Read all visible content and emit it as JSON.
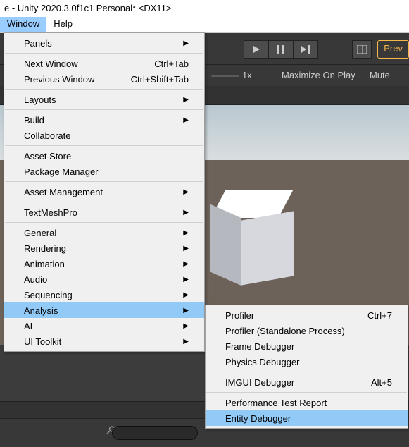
{
  "title": "e - Unity 2020.3.0f1c1 Personal* <DX11>",
  "menubar": {
    "window": "Window",
    "help": "Help"
  },
  "toolbar": {
    "preview": "Prev"
  },
  "playbar": {
    "scale": "1x",
    "maximize": "Maximize On Play",
    "mute": "Mute"
  },
  "window_menu": {
    "panels": "Panels",
    "next_window": "Next Window",
    "next_window_sc": "Ctrl+Tab",
    "previous_window": "Previous Window",
    "previous_window_sc": "Ctrl+Shift+Tab",
    "layouts": "Layouts",
    "build": "Build",
    "collaborate": "Collaborate",
    "asset_store": "Asset Store",
    "package_manager": "Package Manager",
    "asset_management": "Asset Management",
    "textmeshpro": "TextMeshPro",
    "general": "General",
    "rendering": "Rendering",
    "animation": "Animation",
    "audio": "Audio",
    "sequencing": "Sequencing",
    "analysis": "Analysis",
    "ai": "AI",
    "ui_toolkit": "UI Toolkit"
  },
  "analysis_menu": {
    "profiler": "Profiler",
    "profiler_sc": "Ctrl+7",
    "profiler_sa": "Profiler (Standalone Process)",
    "frame_debugger": "Frame Debugger",
    "physics_debugger": "Physics Debugger",
    "imgui_debugger": "IMGUI Debugger",
    "imgui_debugger_sc": "Alt+5",
    "perf_test": "Performance Test Report",
    "entity_debugger": "Entity Debugger"
  }
}
